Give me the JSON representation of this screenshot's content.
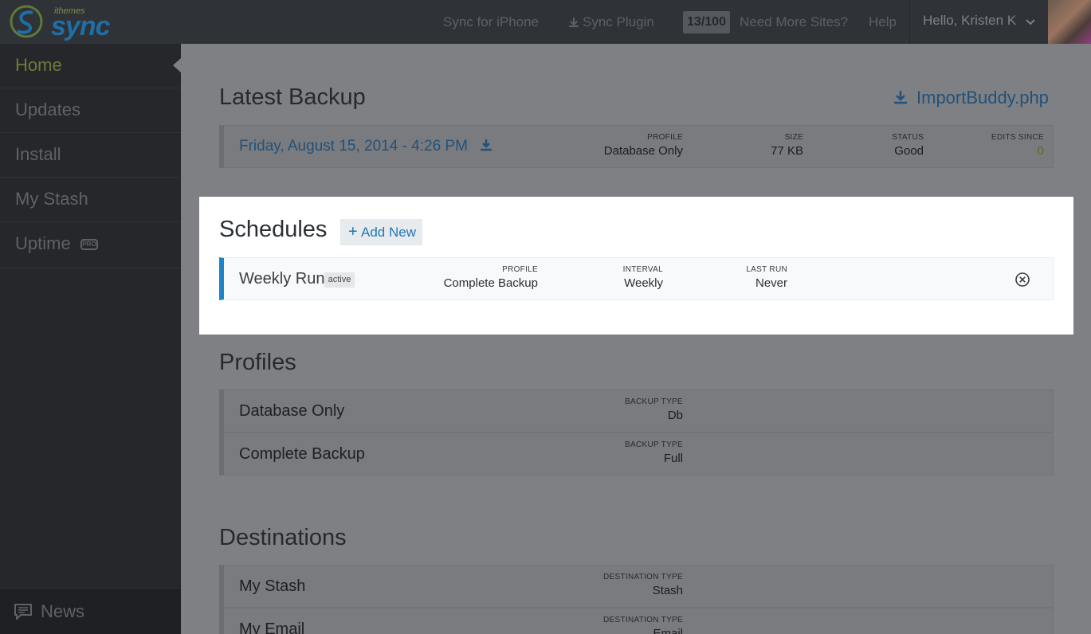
{
  "brand": {
    "small": "ithemes",
    "big": "sync"
  },
  "topnav": {
    "sync_iphone": "Sync for iPhone",
    "sync_plugin": "Sync Plugin",
    "site_count": "13/100",
    "need_more": "Need More Sites?",
    "help": "Help",
    "greeting": "Hello, Kristen K"
  },
  "sidebar": {
    "items": [
      {
        "label": "Home"
      },
      {
        "label": "Updates"
      },
      {
        "label": "Install"
      },
      {
        "label": "My Stash"
      },
      {
        "label": "Uptime",
        "badge": "PRO"
      }
    ],
    "active": "Home",
    "news": "News"
  },
  "latest_backup": {
    "title": "Latest Backup",
    "import_link": "ImportBuddy.php",
    "date": "Friday, August 15, 2014 - 4:26 PM",
    "profile_label": "PROFILE",
    "profile_value": "Database Only",
    "size_label": "SIZE",
    "size_value": "77 KB",
    "status_label": "STATUS",
    "status_value": "Good",
    "edits_label": "EDITS SINCE",
    "edits_value": "0"
  },
  "schedules": {
    "title": "Schedules",
    "add_new": "Add New",
    "rows": [
      {
        "name": "Weekly Run",
        "badge": "active",
        "profile_label": "PROFILE",
        "profile_value": "Complete Backup",
        "interval_label": "INTERVAL",
        "interval_value": "Weekly",
        "last_run_label": "LAST RUN",
        "last_run_value": "Never"
      }
    ]
  },
  "profiles": {
    "title": "Profiles",
    "rows": [
      {
        "name": "Database Only",
        "type_label": "BACKUP TYPE",
        "type_value": "Db"
      },
      {
        "name": "Complete Backup",
        "type_label": "BACKUP TYPE",
        "type_value": "Full"
      }
    ]
  },
  "destinations": {
    "title": "Destinations",
    "rows": [
      {
        "name": "My Stash",
        "type_label": "DESTINATION TYPE",
        "type_value": "Stash"
      },
      {
        "name": "My Email",
        "type_label": "DESTINATION TYPE",
        "type_value": "Email"
      }
    ]
  },
  "colors": {
    "accent_blue": "#1f84c6",
    "active_green": "#6d7b3c",
    "sidebar_bg": "#25272a",
    "topbar_bg": "#2f3236"
  },
  "icons": {
    "logo": "sync-logo-icon",
    "plugin_download": "download-icon",
    "dropdown": "chevron-down-icon",
    "pro": "pro-badge-icon",
    "news": "chat-bubble-icon",
    "import": "download-icon",
    "backup_download": "download-icon",
    "add": "plus-icon",
    "remove": "close-circle-icon"
  }
}
